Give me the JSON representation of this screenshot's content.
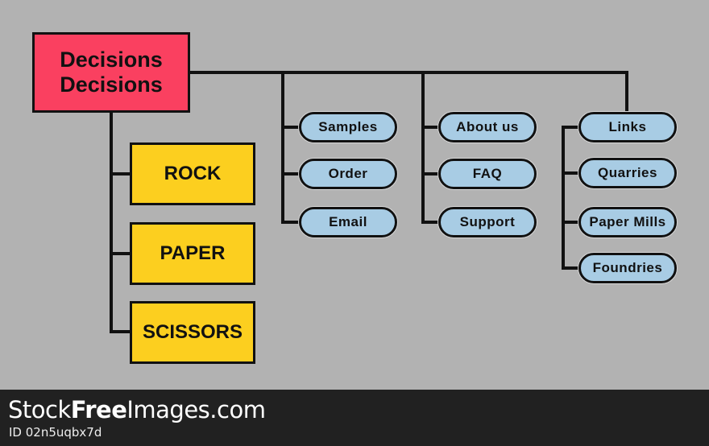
{
  "root": {
    "line1": "Decisions",
    "line2": "Decisions"
  },
  "left_branch": [
    "ROCK",
    "PAPER",
    "SCISSORS"
  ],
  "branch_1": [
    "Samples",
    "Order",
    "Email"
  ],
  "branch_2": [
    "About us",
    "FAQ",
    "Support"
  ],
  "branch_3": [
    "Links",
    "Quarries",
    "Paper Mills",
    "Foundries"
  ],
  "colors": {
    "background": "#b2b2b2",
    "root": "#fa4060",
    "yellow": "#fccf1f",
    "pill": "#a8cce4",
    "line": "#111111",
    "footer": "#212121"
  },
  "footer": {
    "brand_part1": "Stock",
    "brand_part2": "Free",
    "brand_part3": "Images.com",
    "image_id": "ID 02n5uqbx7d"
  }
}
